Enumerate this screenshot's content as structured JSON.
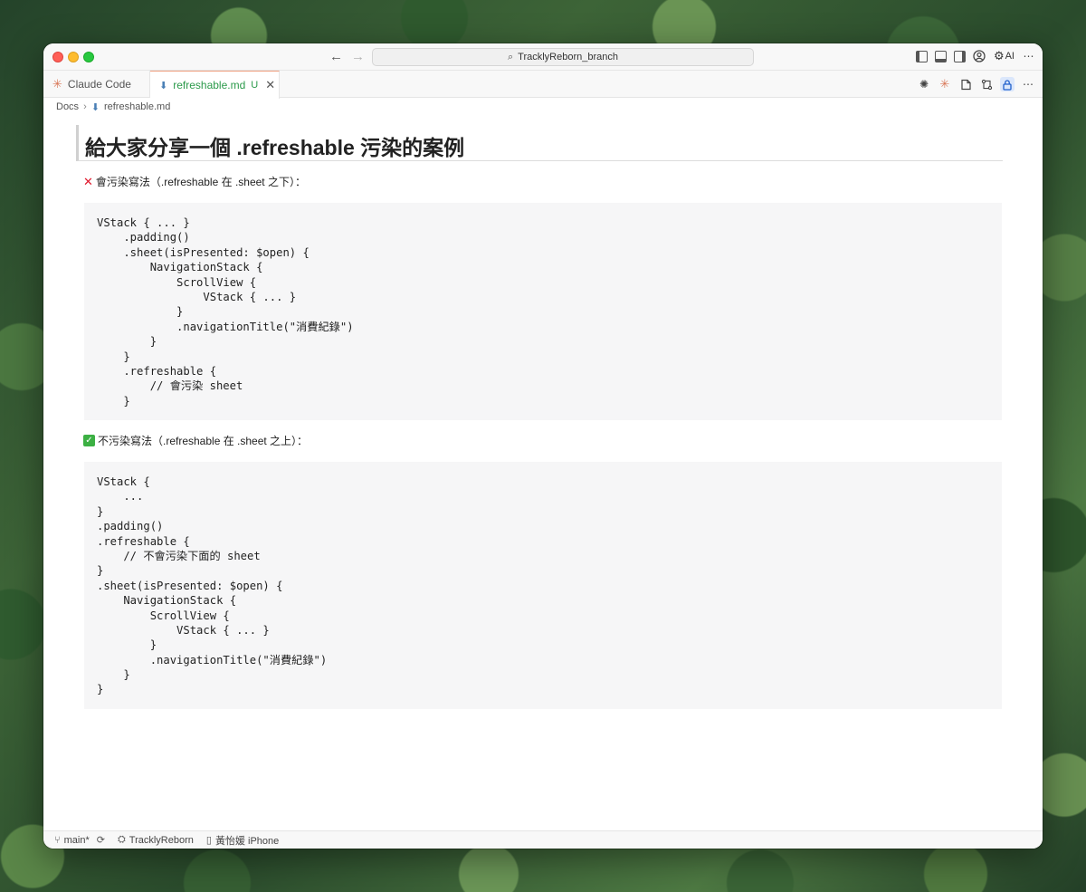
{
  "titlebar": {
    "search_text": "TracklyReborn_branch",
    "ai_label": "AI"
  },
  "tabs": [
    {
      "label": "Claude Code"
    },
    {
      "label": "refreshable.md",
      "status": "U"
    }
  ],
  "breadcrumb": {
    "root": "Docs",
    "file": "refreshable.md"
  },
  "doc": {
    "title": "給大家分享一個 .refreshable 污染的案例",
    "bad_label": "會污染寫法（.refreshable 在 .sheet 之下）：",
    "bad_code": [
      "VStack { ... }",
      "    .padding()",
      "    .sheet(isPresented: $open) {",
      "        NavigationStack {",
      "            ScrollView {",
      "                VStack { ... }",
      "            }",
      "            .navigationTitle(\"消費紀錄\")",
      "        }",
      "    }",
      "    .refreshable {",
      "        // 會污染 sheet",
      "    }"
    ],
    "good_label": "不污染寫法（.refreshable 在 .sheet 之上）：",
    "good_code": [
      "VStack {",
      "    ...",
      "}",
      ".padding()",
      ".refreshable {",
      "    // 不會污染下面的 sheet",
      "}",
      ".sheet(isPresented: $open) {",
      "    NavigationStack {",
      "        ScrollView {",
      "            VStack { ... }",
      "        }",
      "        .navigationTitle(\"消費紀錄\")",
      "    }",
      "}"
    ]
  },
  "statusbar": {
    "branch": "main*",
    "project": "TracklyReborn",
    "device": "黃怡媛 iPhone"
  },
  "colors": {
    "accent_green": "#2b9a4a",
    "claude_orange": "#d97757",
    "error_red": "#e0182c"
  }
}
